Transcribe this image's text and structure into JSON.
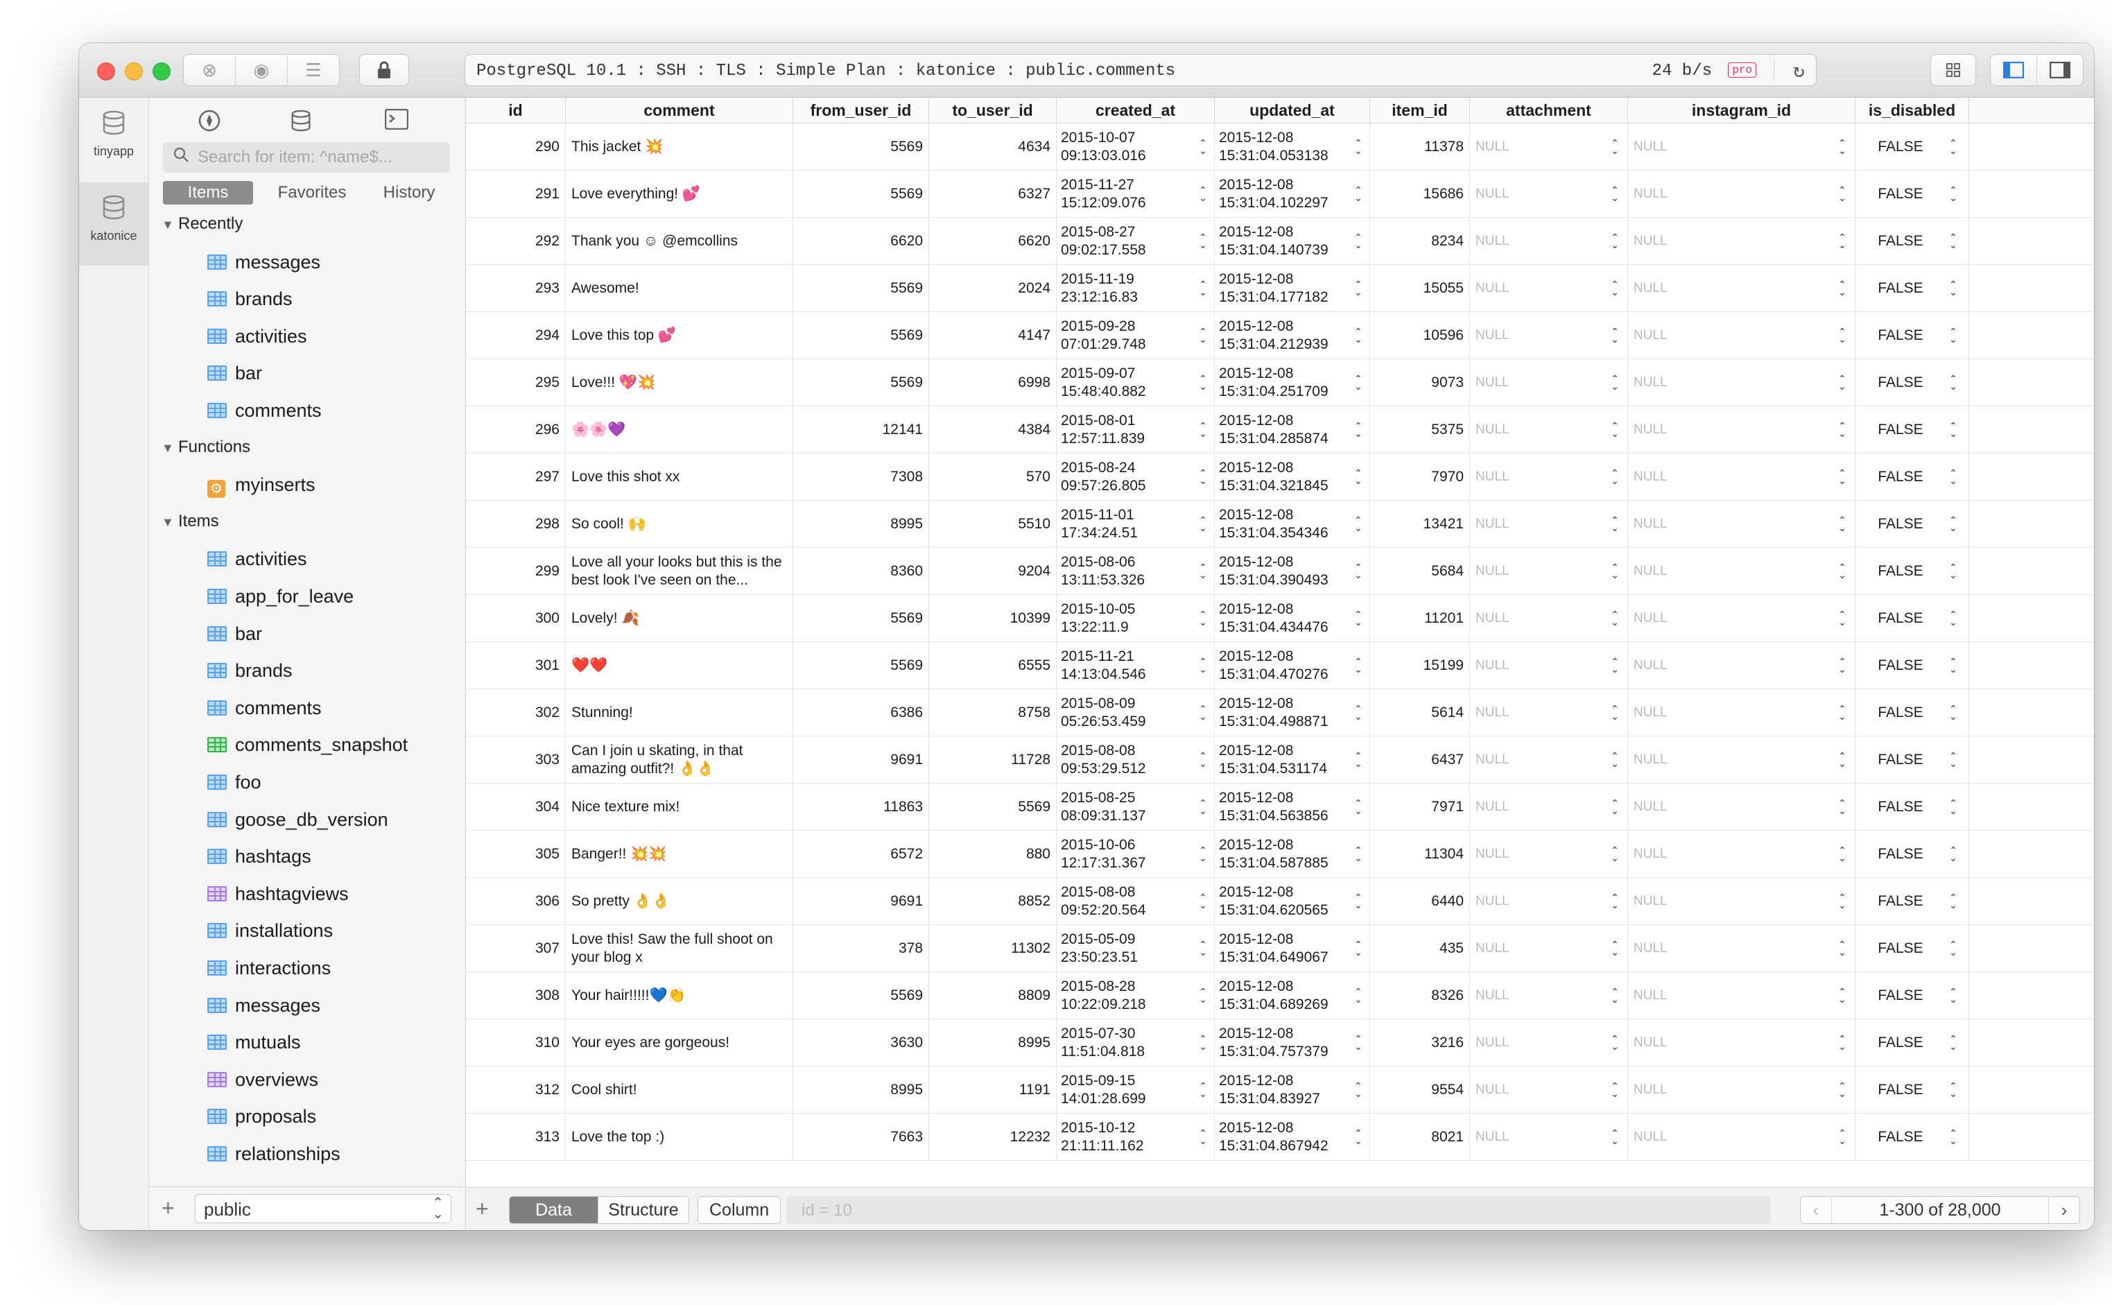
{
  "window": {
    "connection": "PostgreSQL 10.1 : SSH : TLS : Simple Plan : katonice : public.comments",
    "rate": "24 b/s",
    "pro_badge": "pro"
  },
  "rail": [
    {
      "label": "tinyapp",
      "icon": "database-icon"
    },
    {
      "label": "katonice",
      "icon": "database-icon",
      "active": true
    }
  ],
  "sidebar": {
    "search_placeholder": "Search for item: ^name$...",
    "tabs": [
      "Items",
      "Favorites",
      "History"
    ],
    "sections": [
      {
        "title": "Recently",
        "items": [
          {
            "name": "messages",
            "kind": "table"
          },
          {
            "name": "brands",
            "kind": "table"
          },
          {
            "name": "activities",
            "kind": "table"
          },
          {
            "name": "bar",
            "kind": "table"
          },
          {
            "name": "comments",
            "kind": "table"
          }
        ]
      },
      {
        "title": "Functions",
        "items": [
          {
            "name": "myinserts",
            "kind": "function"
          }
        ]
      },
      {
        "title": "Items",
        "items": [
          {
            "name": "activities",
            "kind": "table"
          },
          {
            "name": "app_for_leave",
            "kind": "table"
          },
          {
            "name": "bar",
            "kind": "table"
          },
          {
            "name": "brands",
            "kind": "table"
          },
          {
            "name": "comments",
            "kind": "table"
          },
          {
            "name": "comments_snapshot",
            "kind": "matview"
          },
          {
            "name": "foo",
            "kind": "table"
          },
          {
            "name": "goose_db_version",
            "kind": "table"
          },
          {
            "name": "hashtags",
            "kind": "table"
          },
          {
            "name": "hashtagviews",
            "kind": "view"
          },
          {
            "name": "installations",
            "kind": "table"
          },
          {
            "name": "interactions",
            "kind": "table"
          },
          {
            "name": "messages",
            "kind": "table"
          },
          {
            "name": "mutuals",
            "kind": "table"
          },
          {
            "name": "overviews",
            "kind": "view"
          },
          {
            "name": "proposals",
            "kind": "table"
          },
          {
            "name": "relationships",
            "kind": "table"
          }
        ]
      }
    ],
    "schema": "public"
  },
  "grid": {
    "columns": [
      "id",
      "comment",
      "from_user_id",
      "to_user_id",
      "created_at",
      "updated_at",
      "item_id",
      "attachment",
      "instagram_id",
      "is_disabled"
    ],
    "rows": [
      {
        "id": "290",
        "comment": "This jacket 💥",
        "from": "5569",
        "to": "4634",
        "c1": "2015-10-07",
        "c2": "09:13:03.016",
        "u1": "2015-12-08",
        "u2": "15:31:04.053138",
        "item": "11378",
        "att": "NULL",
        "ig": "NULL",
        "dis": "FALSE"
      },
      {
        "id": "291",
        "comment": "Love everything! 💕",
        "from": "5569",
        "to": "6327",
        "c1": "2015-11-27",
        "c2": "15:12:09.076",
        "u1": "2015-12-08",
        "u2": "15:31:04.102297",
        "item": "15686",
        "att": "NULL",
        "ig": "NULL",
        "dis": "FALSE"
      },
      {
        "id": "292",
        "comment": "Thank you ☺ @emcollins",
        "from": "6620",
        "to": "6620",
        "c1": "2015-08-27",
        "c2": "09:02:17.558",
        "u1": "2015-12-08",
        "u2": "15:31:04.140739",
        "item": "8234",
        "att": "NULL",
        "ig": "NULL",
        "dis": "FALSE"
      },
      {
        "id": "293",
        "comment": "Awesome!",
        "from": "5569",
        "to": "2024",
        "c1": "2015-11-19",
        "c2": "23:12:16.83",
        "u1": "2015-12-08",
        "u2": "15:31:04.177182",
        "item": "15055",
        "att": "NULL",
        "ig": "NULL",
        "dis": "FALSE"
      },
      {
        "id": "294",
        "comment": "Love this top 💕",
        "from": "5569",
        "to": "4147",
        "c1": "2015-09-28",
        "c2": "07:01:29.748",
        "u1": "2015-12-08",
        "u2": "15:31:04.212939",
        "item": "10596",
        "att": "NULL",
        "ig": "NULL",
        "dis": "FALSE"
      },
      {
        "id": "295",
        "comment": "Love!!! 💖💥",
        "from": "5569",
        "to": "6998",
        "c1": "2015-09-07",
        "c2": "15:48:40.882",
        "u1": "2015-12-08",
        "u2": "15:31:04.251709",
        "item": "9073",
        "att": "NULL",
        "ig": "NULL",
        "dis": "FALSE"
      },
      {
        "id": "296",
        "comment": "🌸🌸💜",
        "from": "12141",
        "to": "4384",
        "c1": "2015-08-01",
        "c2": "12:57:11.839",
        "u1": "2015-12-08",
        "u2": "15:31:04.285874",
        "item": "5375",
        "att": "NULL",
        "ig": "NULL",
        "dis": "FALSE"
      },
      {
        "id": "297",
        "comment": "Love this shot xx",
        "from": "7308",
        "to": "570",
        "c1": "2015-08-24",
        "c2": "09:57:26.805",
        "u1": "2015-12-08",
        "u2": "15:31:04.321845",
        "item": "7970",
        "att": "NULL",
        "ig": "NULL",
        "dis": "FALSE"
      },
      {
        "id": "298",
        "comment": "So cool! 🙌",
        "from": "8995",
        "to": "5510",
        "c1": "2015-11-01",
        "c2": "17:34:24.51",
        "u1": "2015-12-08",
        "u2": "15:31:04.354346",
        "item": "13421",
        "att": "NULL",
        "ig": "NULL",
        "dis": "FALSE"
      },
      {
        "id": "299",
        "comment": "Love all your looks but this is the best look I've seen on the...",
        "from": "8360",
        "to": "9204",
        "c1": "2015-08-06",
        "c2": "13:11:53.326",
        "u1": "2015-12-08",
        "u2": "15:31:04.390493",
        "item": "5684",
        "att": "NULL",
        "ig": "NULL",
        "dis": "FALSE"
      },
      {
        "id": "300",
        "comment": "Lovely! 🍂",
        "from": "5569",
        "to": "10399",
        "c1": "2015-10-05",
        "c2": "13:22:11.9",
        "u1": "2015-12-08",
        "u2": "15:31:04.434476",
        "item": "11201",
        "att": "NULL",
        "ig": "NULL",
        "dis": "FALSE"
      },
      {
        "id": "301",
        "comment": "❤️❤️",
        "from": "5569",
        "to": "6555",
        "c1": "2015-11-21",
        "c2": "14:13:04.546",
        "u1": "2015-12-08",
        "u2": "15:31:04.470276",
        "item": "15199",
        "att": "NULL",
        "ig": "NULL",
        "dis": "FALSE"
      },
      {
        "id": "302",
        "comment": "Stunning!",
        "from": "6386",
        "to": "8758",
        "c1": "2015-08-09",
        "c2": "05:26:53.459",
        "u1": "2015-12-08",
        "u2": "15:31:04.498871",
        "item": "5614",
        "att": "NULL",
        "ig": "NULL",
        "dis": "FALSE"
      },
      {
        "id": "303",
        "comment": "Can I join u skating, in that amazing outfit?! 👌👌",
        "from": "9691",
        "to": "11728",
        "c1": "2015-08-08",
        "c2": "09:53:29.512",
        "u1": "2015-12-08",
        "u2": "15:31:04.531174",
        "item": "6437",
        "att": "NULL",
        "ig": "NULL",
        "dis": "FALSE"
      },
      {
        "id": "304",
        "comment": "Nice texture mix!",
        "from": "11863",
        "to": "5569",
        "c1": "2015-08-25",
        "c2": "08:09:31.137",
        "u1": "2015-12-08",
        "u2": "15:31:04.563856",
        "item": "7971",
        "att": "NULL",
        "ig": "NULL",
        "dis": "FALSE"
      },
      {
        "id": "305",
        "comment": "Banger!! 💥💥",
        "from": "6572",
        "to": "880",
        "c1": "2015-10-06",
        "c2": "12:17:31.367",
        "u1": "2015-12-08",
        "u2": "15:31:04.587885",
        "item": "11304",
        "att": "NULL",
        "ig": "NULL",
        "dis": "FALSE"
      },
      {
        "id": "306",
        "comment": "So pretty 👌👌",
        "from": "9691",
        "to": "8852",
        "c1": "2015-08-08",
        "c2": "09:52:20.564",
        "u1": "2015-12-08",
        "u2": "15:31:04.620565",
        "item": "6440",
        "att": "NULL",
        "ig": "NULL",
        "dis": "FALSE"
      },
      {
        "id": "307",
        "comment": "Love this! Saw the full shoot on your blog x",
        "from": "378",
        "to": "11302",
        "c1": "2015-05-09",
        "c2": "23:50:23.51",
        "u1": "2015-12-08",
        "u2": "15:31:04.649067",
        "item": "435",
        "att": "NULL",
        "ig": "NULL",
        "dis": "FALSE"
      },
      {
        "id": "308",
        "comment": "Your hair!!!!!💙👏",
        "from": "5569",
        "to": "8809",
        "c1": "2015-08-28",
        "c2": "10:22:09.218",
        "u1": "2015-12-08",
        "u2": "15:31:04.689269",
        "item": "8326",
        "att": "NULL",
        "ig": "NULL",
        "dis": "FALSE"
      },
      {
        "id": "310",
        "comment": "Your eyes are gorgeous!",
        "from": "3630",
        "to": "8995",
        "c1": "2015-07-30",
        "c2": "11:51:04.818",
        "u1": "2015-12-08",
        "u2": "15:31:04.757379",
        "item": "3216",
        "att": "NULL",
        "ig": "NULL",
        "dis": "FALSE"
      },
      {
        "id": "312",
        "comment": "Cool shirt!",
        "from": "8995",
        "to": "1191",
        "c1": "2015-09-15",
        "c2": "14:01:28.699",
        "u1": "2015-12-08",
        "u2": "15:31:04.83927",
        "item": "9554",
        "att": "NULL",
        "ig": "NULL",
        "dis": "FALSE"
      },
      {
        "id": "313",
        "comment": "Love the top :)",
        "from": "7663",
        "to": "12232",
        "c1": "2015-10-12",
        "c2": "21:11:11.162",
        "u1": "2015-12-08",
        "u2": "15:31:04.867942",
        "item": "8021",
        "att": "NULL",
        "ig": "NULL",
        "dis": "FALSE"
      }
    ]
  },
  "bottombar": {
    "views": [
      "Data",
      "Structure"
    ],
    "column_label": "Column",
    "filter_placeholder": "id = 10",
    "page_label": "1-300 of 28,000"
  }
}
